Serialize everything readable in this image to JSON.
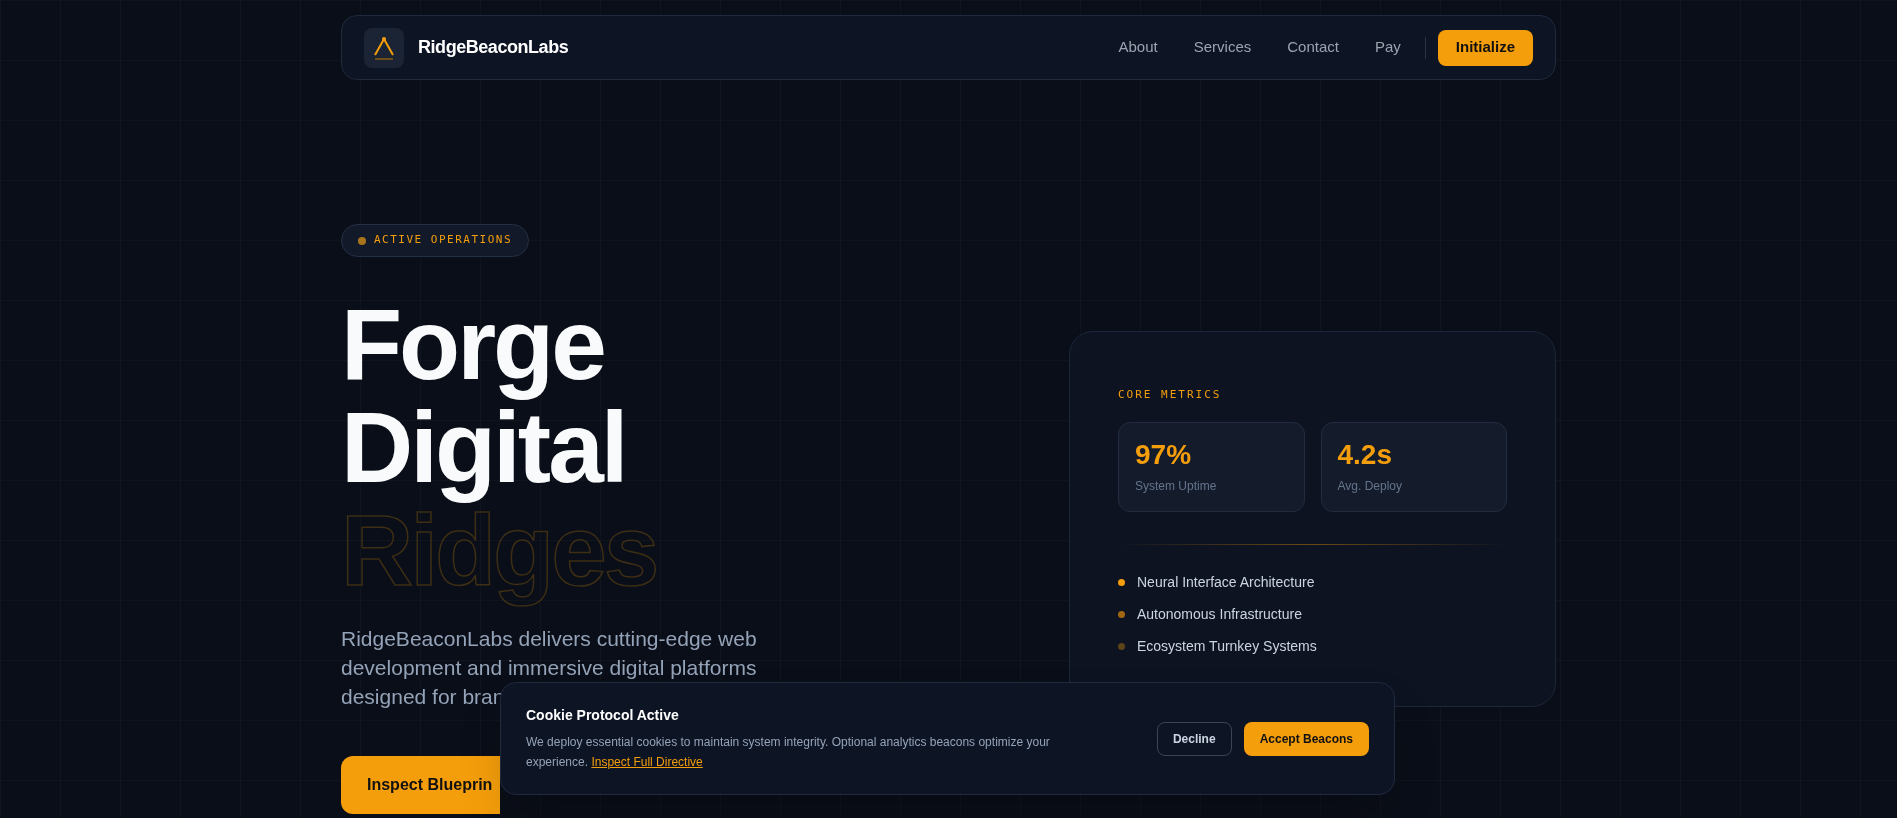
{
  "nav": {
    "brand": "RidgeBeaconLabs",
    "links": [
      "About",
      "Services",
      "Contact",
      "Pay"
    ],
    "cta": "Initialize"
  },
  "hero": {
    "badge": "ACTIVE OPERATIONS",
    "title_lines": [
      "Forge",
      "Digital"
    ],
    "outline_line": "Ridges",
    "description": "RidgeBeaconLabs delivers cutting-edge web development and immersive digital platforms designed for bran",
    "primary_button": "Inspect Blueprin"
  },
  "metrics_card": {
    "label": "CORE METRICS",
    "metrics": [
      {
        "value": "97%",
        "caption": "System Uptime"
      },
      {
        "value": "4.2s",
        "caption": "Avg. Deploy"
      }
    ],
    "features": [
      {
        "text": "Neural Interface Architecture",
        "color": "#f59e0b"
      },
      {
        "text": "Autonomous Infrastructure",
        "color": "#a16612"
      },
      {
        "text": "Ecosystem Turnkey Systems",
        "color": "#5c4318"
      }
    ]
  },
  "cookie_banner": {
    "title": "Cookie Protocol Active",
    "text": "We deploy essential cookies to maintain system integrity. Optional analytics beacons optimize your experience.",
    "link": "Inspect Full Directive",
    "decline": "Decline",
    "accept": "Accept Beacons"
  }
}
